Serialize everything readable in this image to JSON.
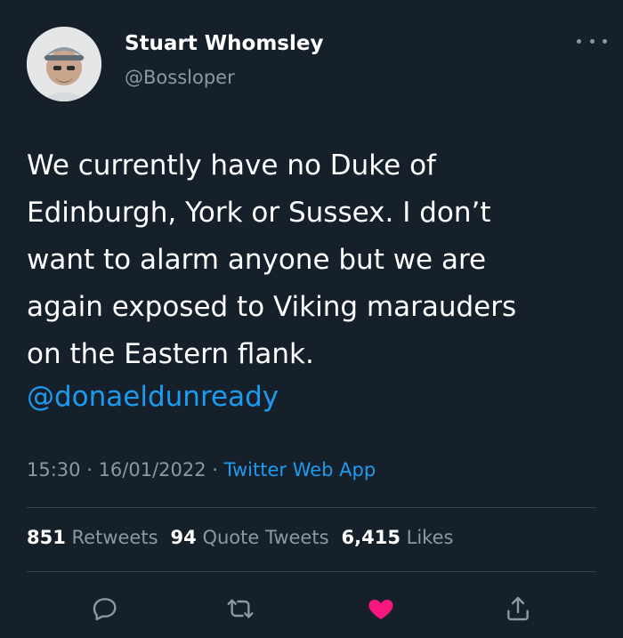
{
  "user": {
    "name": "Stuart Whomsley",
    "handle": "@Bossloper"
  },
  "tweet": {
    "text": "We currently have no Duke of\nEdinburgh, York or Sussex. I don’t\nwant to alarm anyone but we are\nagain exposed to Viking marauders\non the Eastern flank.",
    "mention": "@donaeldunready",
    "time": "15:30",
    "date": "16/01/2022",
    "separator": " · ",
    "source": "Twitter Web App"
  },
  "stats": {
    "retweets_count": "851",
    "retweets_label": "Retweets",
    "quotes_count": "94",
    "quotes_label": "Quote Tweets",
    "likes_count": "6,415",
    "likes_label": "Likes"
  },
  "icons": {
    "reply": "reply-icon",
    "retweet": "retweet-icon",
    "like": "heart-icon",
    "share": "share-icon",
    "more": "more-icon"
  },
  "colors": {
    "background": "#15202b",
    "accent": "#1d9bf0",
    "like": "#f91880",
    "muted": "#8b98a5"
  }
}
